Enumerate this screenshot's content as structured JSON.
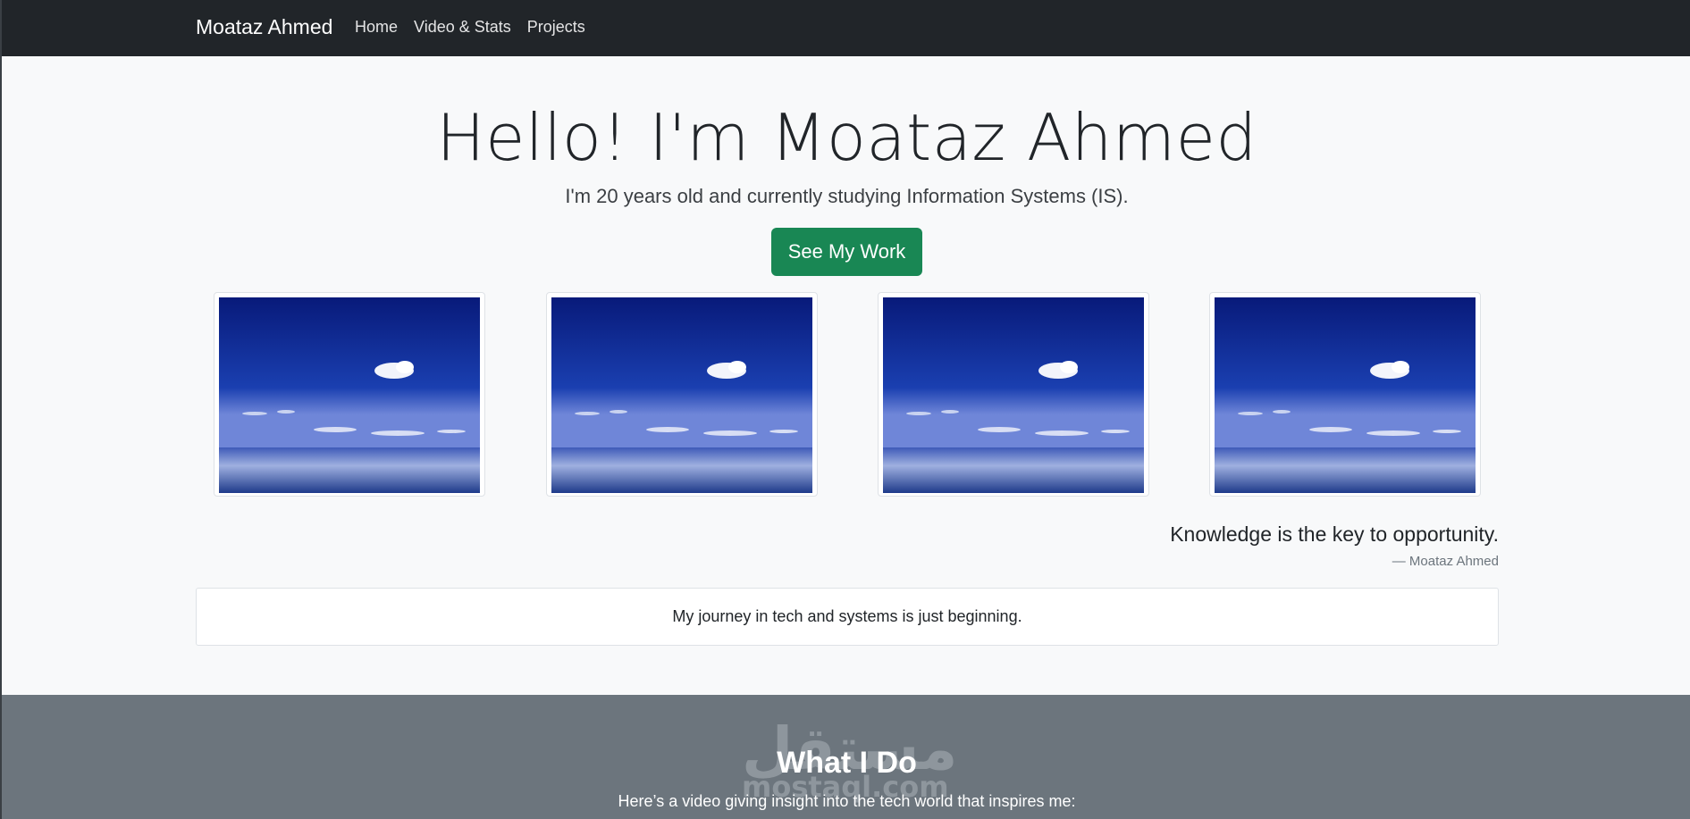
{
  "navbar": {
    "brand": "Moataz Ahmed",
    "links": [
      "Home",
      "Video & Stats",
      "Projects"
    ],
    "background": "#212529"
  },
  "hero": {
    "title": "Hello! I'm Moataz Ahmed",
    "subtitle": "I'm 20 years old and currently studying Information Systems (IS).",
    "cta_label": "See My Work",
    "cta_color": "#198754"
  },
  "gallery": {
    "images": [
      "ocean-sky-photo",
      "ocean-sky-photo",
      "ocean-sky-photo",
      "ocean-sky-photo"
    ]
  },
  "quote": {
    "text": "Knowledge is the key to opportunity.",
    "author": "— Moataz Ahmed"
  },
  "card": {
    "text": "My journey in tech and systems is just beginning."
  },
  "what_i_do": {
    "title": "What I Do",
    "subtitle": "Here’s a video giving insight into the tech world that inspires me:",
    "background": "#6c757d"
  },
  "watermark": {
    "arabic": "مستقل",
    "latin": "mostaql.com"
  }
}
